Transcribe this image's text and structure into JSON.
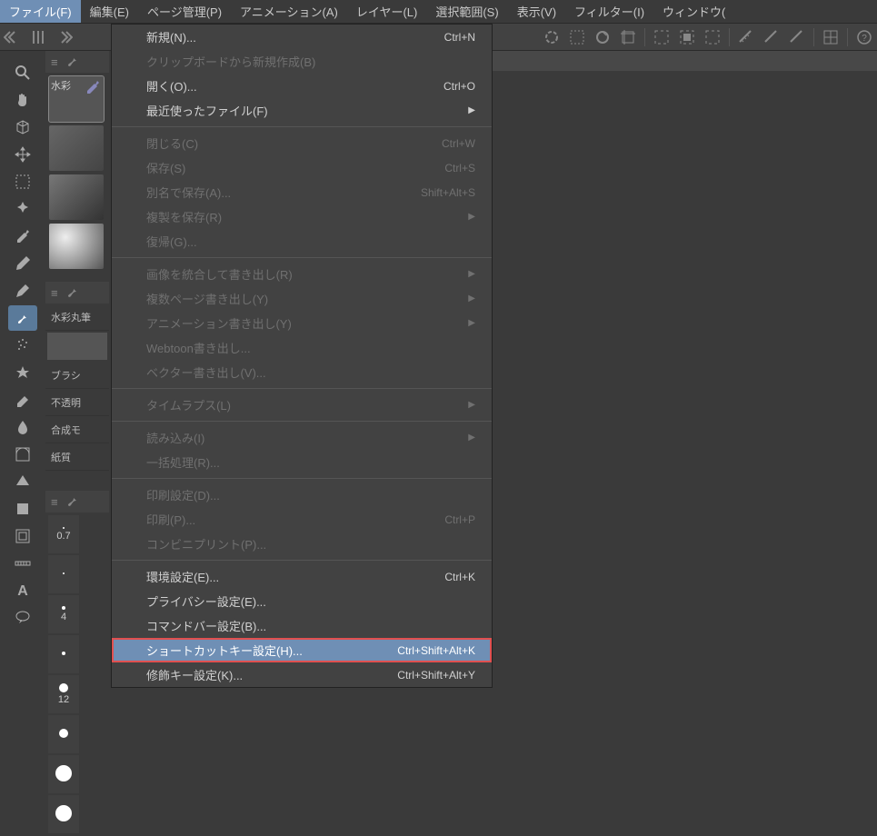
{
  "menubar": {
    "items": [
      {
        "label": "ファイル(F)",
        "active": true
      },
      {
        "label": "編集(E)"
      },
      {
        "label": "ページ管理(P)"
      },
      {
        "label": "アニメーション(A)"
      },
      {
        "label": "レイヤー(L)"
      },
      {
        "label": "選択範囲(S)"
      },
      {
        "label": "表示(V)"
      },
      {
        "label": "フィルター(I)"
      },
      {
        "label": "ウィンドウ("
      }
    ]
  },
  "dropdown": {
    "items": [
      {
        "label": "新規(N)...",
        "shortcut": "Ctrl+N"
      },
      {
        "label": "クリップボードから新規作成(B)",
        "disabled": true
      },
      {
        "label": "開く(O)...",
        "shortcut": "Ctrl+O"
      },
      {
        "label": "最近使ったファイル(F)",
        "submenu": true
      },
      {
        "sep": true
      },
      {
        "label": "閉じる(C)",
        "shortcut": "Ctrl+W",
        "disabled": true
      },
      {
        "label": "保存(S)",
        "shortcut": "Ctrl+S",
        "disabled": true
      },
      {
        "label": "別名で保存(A)...",
        "shortcut": "Shift+Alt+S",
        "disabled": true
      },
      {
        "label": "複製を保存(R)",
        "submenu": true,
        "disabled": true
      },
      {
        "label": "復帰(G)...",
        "disabled": true
      },
      {
        "sep": true
      },
      {
        "label": "画像を統合して書き出し(R)",
        "submenu": true,
        "disabled": true
      },
      {
        "label": "複数ページ書き出し(Y)",
        "submenu": true,
        "disabled": true
      },
      {
        "label": "アニメーション書き出し(Y)",
        "submenu": true,
        "disabled": true
      },
      {
        "label": "Webtoon書き出し...",
        "disabled": true
      },
      {
        "label": "ベクター書き出し(V)...",
        "disabled": true
      },
      {
        "sep": true
      },
      {
        "label": "タイムラプス(L)",
        "submenu": true,
        "disabled": true
      },
      {
        "sep": true
      },
      {
        "label": "読み込み(I)",
        "submenu": true,
        "disabled": true
      },
      {
        "label": "一括処理(R)...",
        "disabled": true
      },
      {
        "sep": true
      },
      {
        "label": "印刷設定(D)...",
        "disabled": true
      },
      {
        "label": "印刷(P)...",
        "shortcut": "Ctrl+P",
        "disabled": true
      },
      {
        "label": "コンビニプリント(P)...",
        "disabled": true
      },
      {
        "sep": true
      },
      {
        "label": "環境設定(E)...",
        "shortcut": "Ctrl+K"
      },
      {
        "label": "プライバシー設定(E)..."
      },
      {
        "label": "コマンドバー設定(B)..."
      },
      {
        "label": "ショートカットキー設定(H)...",
        "shortcut": "Ctrl+Shift+Alt+K",
        "highlighted": true,
        "boxed": true
      },
      {
        "label": "修飾キー設定(K)...",
        "shortcut": "Ctrl+Shift+Alt+Y"
      }
    ]
  },
  "brush": {
    "label0": "水彩",
    "label1": "水彩丸筆",
    "prop0": "ブラシ",
    "prop1": "不透明",
    "prop2": "合成モ",
    "prop3": "紙質"
  },
  "sizes": {
    "s0": "0.7",
    "s1": "4",
    "s2": "12"
  }
}
